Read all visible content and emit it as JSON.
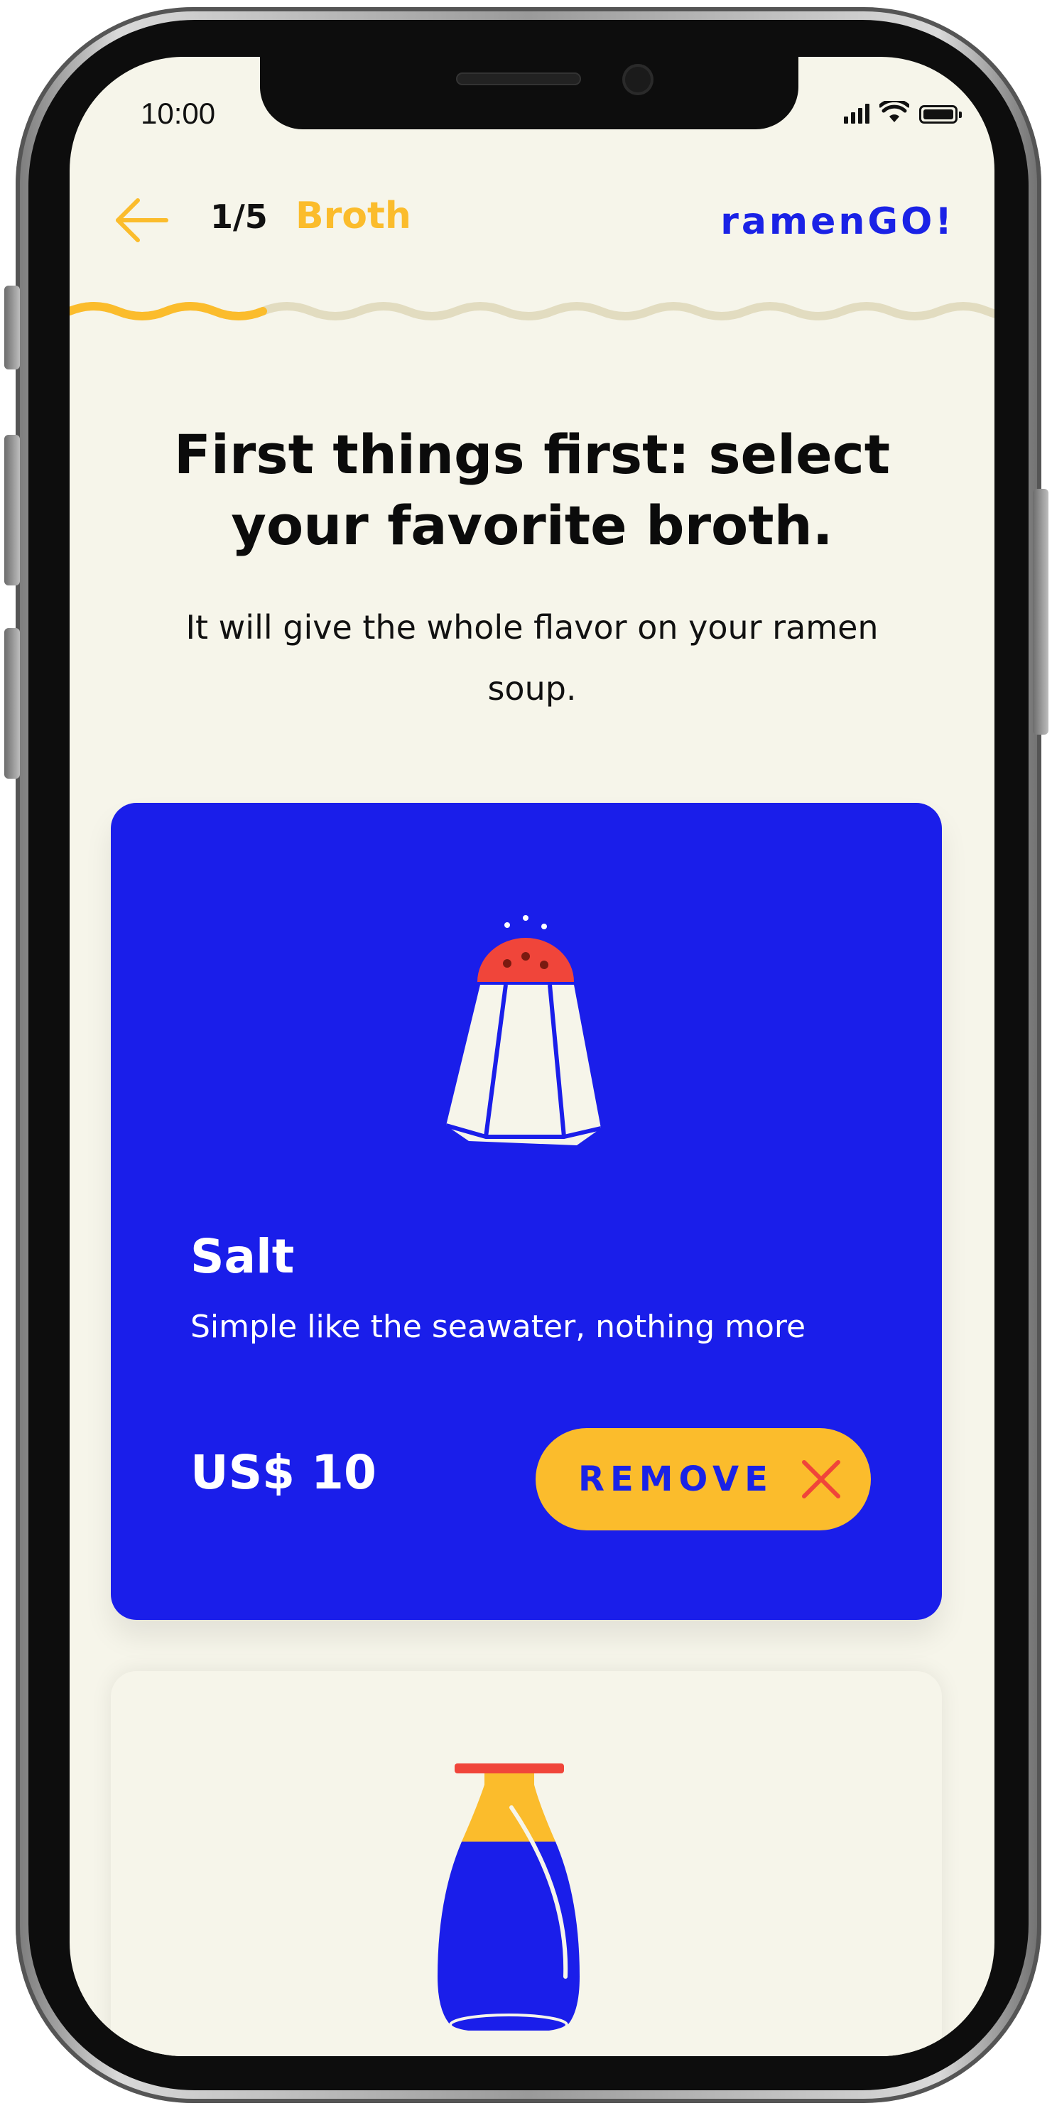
{
  "status_bar": {
    "time": "10:00",
    "icons": [
      "cellular-signal-icon",
      "wifi-icon",
      "battery-icon"
    ]
  },
  "header": {
    "back_icon": "arrow-left-icon",
    "step_count": "1/5",
    "step_name": "Broth",
    "brand": "ramenGO!"
  },
  "progress": {
    "current_step": 1,
    "total_steps": 5
  },
  "intro": {
    "headline": "First things first: select your favorite broth.",
    "subtext": "It will give the whole flavor on your ramen soup."
  },
  "options": [
    {
      "icon": "salt-shaker-icon",
      "title": "Salt",
      "description": "Simple like the seawater, nothing more",
      "price": "US$ 10",
      "button_label": "REMOVE",
      "button_icon": "close-icon",
      "selected": true
    },
    {
      "icon": "soy-sauce-bottle-icon",
      "selected": false
    }
  ],
  "colors": {
    "background": "#f6f5ea",
    "accent_blue": "#1a1eea",
    "accent_yellow": "#fbbc2c",
    "accent_red": "#f0453a",
    "progress_inactive": "#e2dcc0"
  }
}
